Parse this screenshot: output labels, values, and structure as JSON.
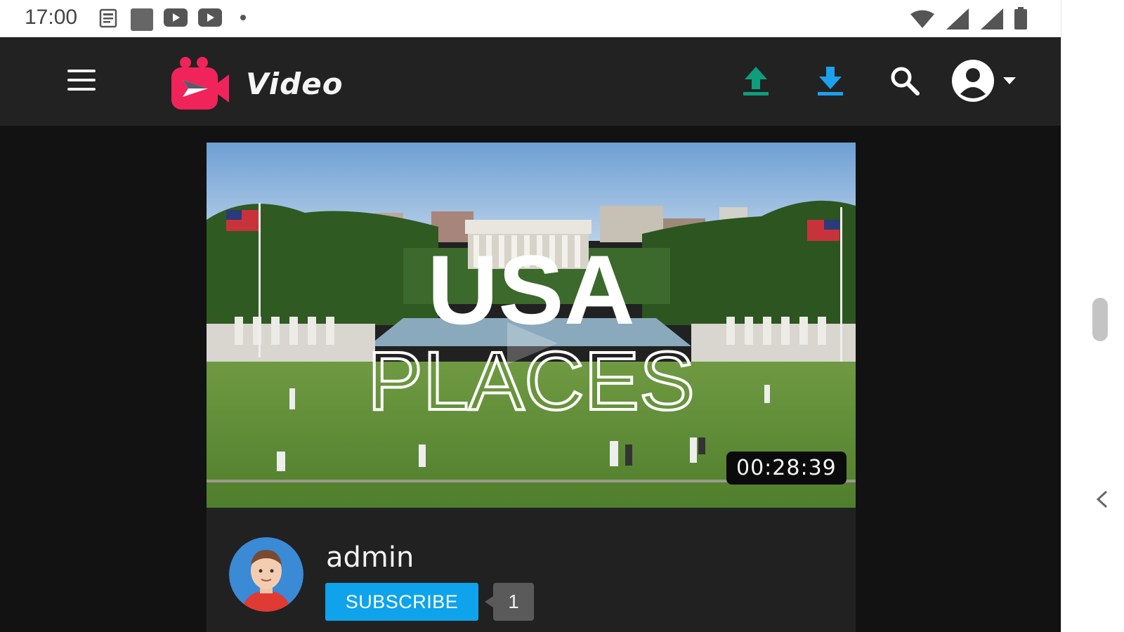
{
  "status_bar": {
    "time": "17:00",
    "notification_icons": [
      "news-icon",
      "square-icon",
      "youtube-icon",
      "youtube-icon"
    ],
    "system_icons": [
      "wifi-icon",
      "signal-icon",
      "signal-icon",
      "battery-icon"
    ]
  },
  "header": {
    "logo_text": "Video",
    "upload_color": "#0e9e7e",
    "download_color": "#1ba1ee",
    "brand_color": "#f0245a"
  },
  "video": {
    "title_overlay_top": "USA",
    "title_overlay_bottom": "PLACES",
    "duration": "00:28:39"
  },
  "channel": {
    "name": "admin",
    "subscribe_label": "SUBSCRIBE",
    "subscriber_count": "1"
  }
}
